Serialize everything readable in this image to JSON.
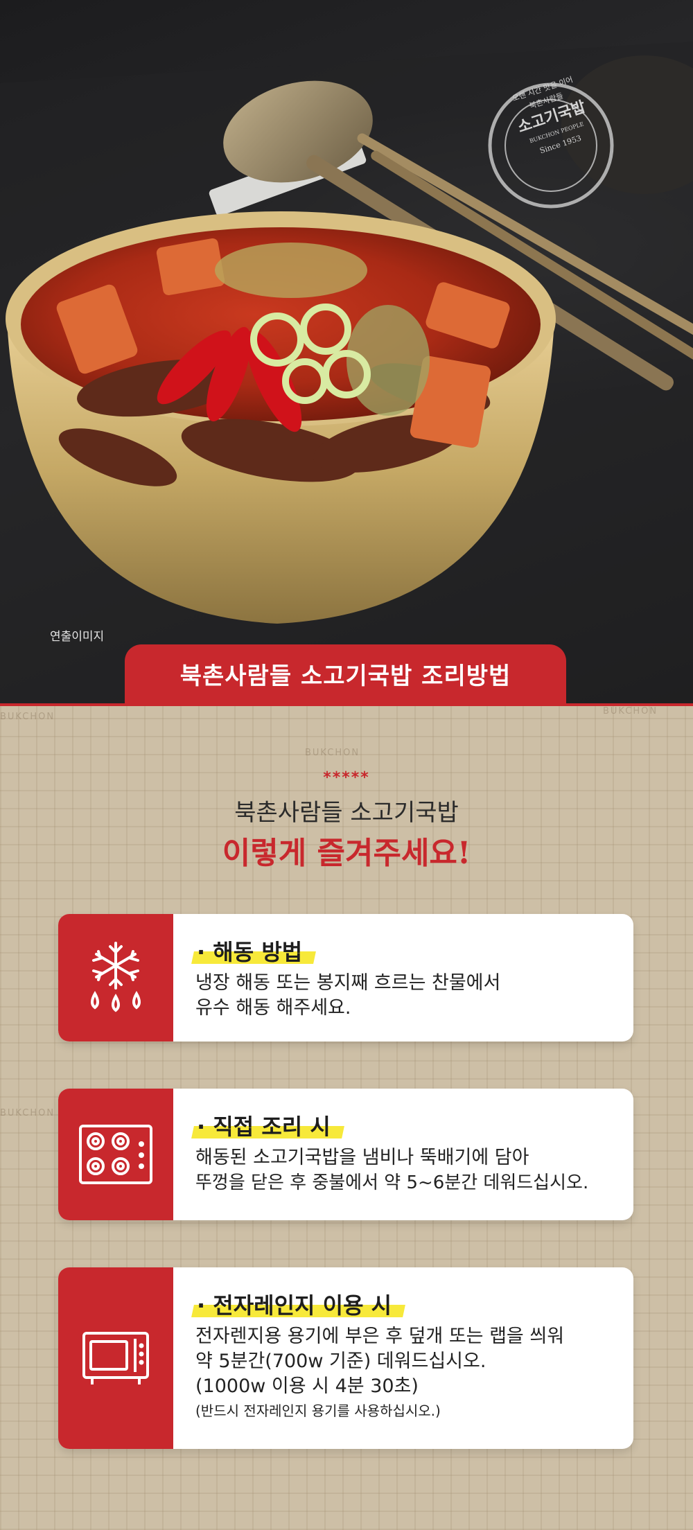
{
  "hero": {
    "caption": "연출이미지",
    "stamp_lines": [
      "오랜 시간 맛을 이어",
      "북촌사람들",
      "소고기국밥",
      "BUKCHON PEOPLE",
      "Since 1953"
    ],
    "title": "북촌사람들 소고기국밥 조리방법"
  },
  "intro": {
    "stars": "*****",
    "line1": "북촌사람들 소고기국밥",
    "line2": "이렇게 즐겨주세요!"
  },
  "watermark": "BUKCHON",
  "cards": [
    {
      "icon": "snowflake-thaw-icon",
      "heading": "· 해동 방법",
      "lines": [
        "냉장 해동 또는 봉지째 흐르는 찬물에서",
        "유수 해동 해주세요."
      ]
    },
    {
      "icon": "stove-burner-icon",
      "heading": "· 직접 조리 시",
      "lines": [
        "해동된 소고기국밥을 냄비나 뚝배기에 담아",
        "뚜껑을 닫은 후 중불에서 약 5~6분간 데워드십시오."
      ]
    },
    {
      "icon": "microwave-icon",
      "heading": "· 전자레인지 이용 시",
      "lines": [
        "전자렌지용 용기에 부은 후 덮개 또는 랩을 씌워",
        "약 5분간(700w 기준) 데워드십시오.",
        "(1000w 이용 시 4분 30초)"
      ],
      "note": "(반드시 전자레인지 용기를 사용하십시오.)"
    }
  ],
  "colors": {
    "accent_red": "#c8282d",
    "highlight_yellow": "#f7e93a",
    "beige": "#cdbfa6"
  }
}
